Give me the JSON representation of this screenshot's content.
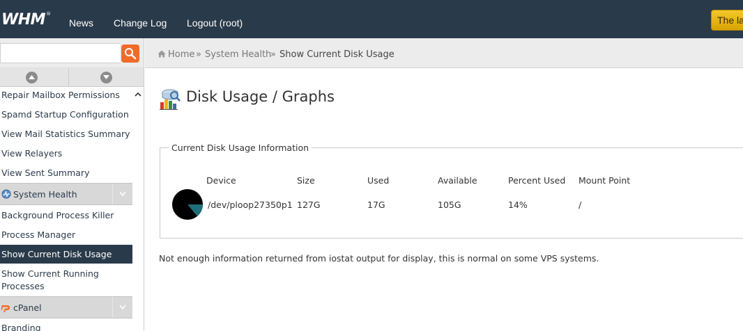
{
  "header": {
    "logo": "WHM",
    "nav": [
      "News",
      "Change Log",
      "Logout (root)"
    ],
    "notice_label": "The la"
  },
  "sidebar": {
    "search_placeholder": "",
    "items_top": [
      "Repair Mailbox Permissions",
      "Spamd Startup Configuration",
      "View Mail Statistics Summary",
      "View Relayers",
      "View Sent Summary"
    ],
    "section_system_health": "System Health",
    "items_system_health": [
      "Background Process Killer",
      "Process Manager",
      "Show Current Disk Usage",
      "Show Current Running",
      "Processes"
    ],
    "section_cpanel": "cPanel",
    "items_cpanel": [
      "Branding"
    ]
  },
  "breadcrumb": {
    "home": "Home",
    "sep": "»",
    "parent": "System Health",
    "current": "Show Current Disk Usage"
  },
  "page": {
    "title": "Disk Usage / Graphs",
    "legend": "Current Disk Usage Information",
    "columns": [
      "Device",
      "Size",
      "Used",
      "Available",
      "Percent Used",
      "Mount Point"
    ],
    "row": {
      "device": "/dev/ploop27350p1",
      "size": "127G",
      "used": "17G",
      "available": "105G",
      "percent_used": "14%",
      "mount_point": "/",
      "percent_value": 0.14
    },
    "note": "Not enough information returned from iostat output for display, this is normal on some VPS systems."
  },
  "colors": {
    "header_bg": "#293a4a",
    "accent_orange": "#f06b2a",
    "pie_used": "#1f6f7a",
    "pie_free": "#000000"
  }
}
